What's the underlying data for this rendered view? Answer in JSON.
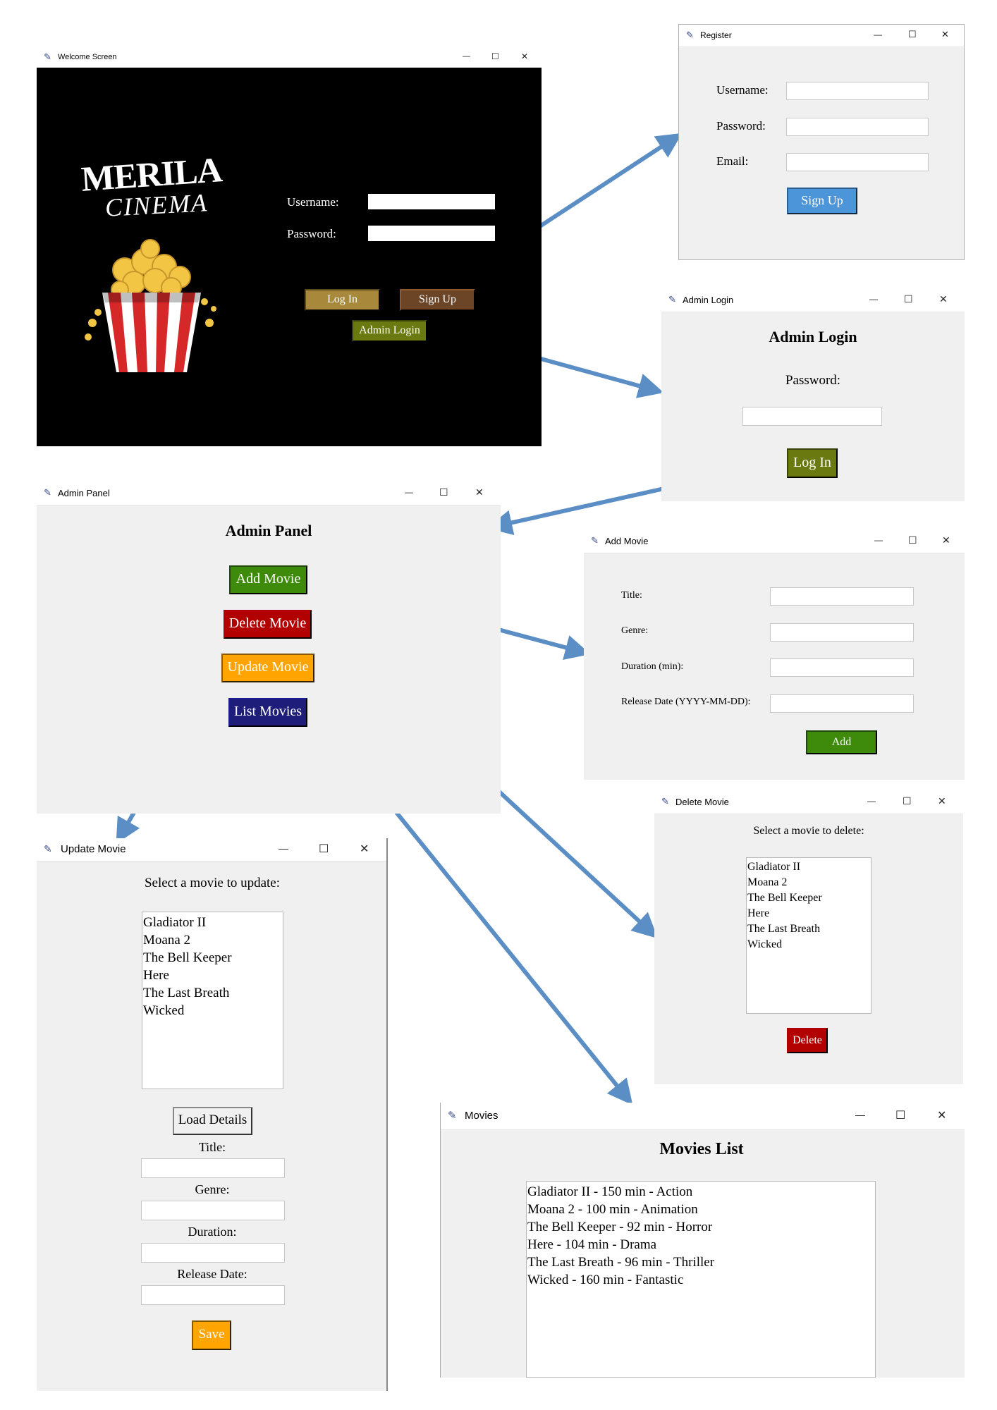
{
  "welcome": {
    "title": "Welcome Screen",
    "logo_top": "MERILA",
    "logo_bottom": "CINEMA",
    "username_label": "Username:",
    "password_label": "Password:",
    "login_btn": "Log In",
    "signup_btn": "Sign Up",
    "admin_btn": "Admin Login"
  },
  "register": {
    "title": "Register",
    "username_label": "Username:",
    "password_label": "Password:",
    "email_label": "Email:",
    "signup_btn": "Sign Up"
  },
  "admin_login": {
    "title": "Admin Login",
    "heading": "Admin Login",
    "password_label": "Password:",
    "login_btn": "Log In"
  },
  "admin_panel": {
    "title": "Admin Panel",
    "heading": "Admin Panel",
    "add_btn": "Add Movie",
    "delete_btn": "Delete Movie",
    "update_btn": "Update Movie",
    "list_btn": "List Movies"
  },
  "add_movie": {
    "title": "Add Movie",
    "title_label": "Title:",
    "genre_label": "Genre:",
    "duration_label": "Duration (min):",
    "release_label": "Release Date (YYYY-MM-DD):",
    "add_btn": "Add"
  },
  "delete_movie": {
    "title": "Delete Movie",
    "prompt": "Select a movie to delete:",
    "movies": [
      "Gladiator II",
      "Moana 2",
      "The Bell Keeper",
      "Here",
      "The Last Breath",
      "Wicked"
    ],
    "delete_btn": "Delete"
  },
  "update_movie": {
    "title": "Update Movie",
    "prompt": "Select a movie to update:",
    "movies": [
      "Gladiator II",
      "Moana 2",
      "The Bell Keeper",
      "Here",
      "The Last Breath",
      "Wicked"
    ],
    "load_btn": "Load Details",
    "title_label": "Title:",
    "genre_label": "Genre:",
    "duration_label": "Duration:",
    "release_label": "Release Date:",
    "save_btn": "Save"
  },
  "movies_list": {
    "title": "Movies",
    "heading": "Movies List",
    "items": [
      "Gladiator II - 150 min - Action",
      "Moana 2 - 100 min - Animation",
      "The Bell Keeper - 92 min - Horror",
      "Here - 104 min - Drama",
      "The Last Breath - 96 min - Thriller",
      "Wicked - 160 min - Fantastic"
    ]
  },
  "window_controls": {
    "minimize": "—",
    "maximize": "☐",
    "close": "✕"
  },
  "colors": {
    "arrow": "#5b8ec4",
    "login_gold": "#a8883b",
    "signup_brown": "#6b4526",
    "admin_olive": "#6b7a10",
    "add_green": "#3e8a0b",
    "delete_red": "#b30000",
    "update_orange": "#ffa400",
    "list_navy": "#1e1e7a",
    "signup_blue": "#4d95d9"
  }
}
